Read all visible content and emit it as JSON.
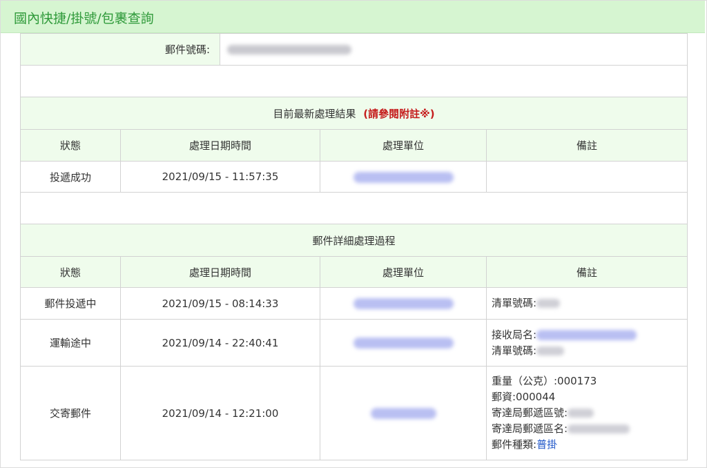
{
  "header": {
    "title": "國內快捷/掛號/包裹查詢"
  },
  "mail_number": {
    "label": "郵件號碼:"
  },
  "latest": {
    "heading": "目前最新處理結果",
    "note_ref": "(請參閱附註※)",
    "columns": [
      "狀態",
      "處理日期時間",
      "處理單位",
      "備註"
    ],
    "row": {
      "status": "投遞成功",
      "datetime": "2021/09/15 - 11:57:35"
    }
  },
  "details": {
    "heading": "郵件詳細處理過程",
    "columns": [
      "狀態",
      "處理日期時間",
      "處理單位",
      "備註"
    ],
    "rows": [
      {
        "status": "郵件投遞中",
        "datetime": "2021/09/15 - 08:14:33",
        "note_label1": "清單號碼:"
      },
      {
        "status": "運輸途中",
        "datetime": "2021/09/14 - 22:40:41",
        "note_label1": "接收局名:",
        "note_label2": "清單號碼:"
      },
      {
        "status": "交寄郵件",
        "datetime": "2021/09/14 - 12:21:00",
        "weight": "重量（公克）:000173",
        "postage": "郵資:000044",
        "zip_label": "寄達局郵遞區號:",
        "zip_name_label": "寄達局郵遞區名:",
        "type_label": "郵件種類:",
        "type_value": "普掛"
      }
    ]
  },
  "colors": {
    "title_green": "#2f9a3a",
    "header_bg": "#effcec",
    "accent_red": "#c51c1c",
    "link_blue": "#1f56c8"
  }
}
